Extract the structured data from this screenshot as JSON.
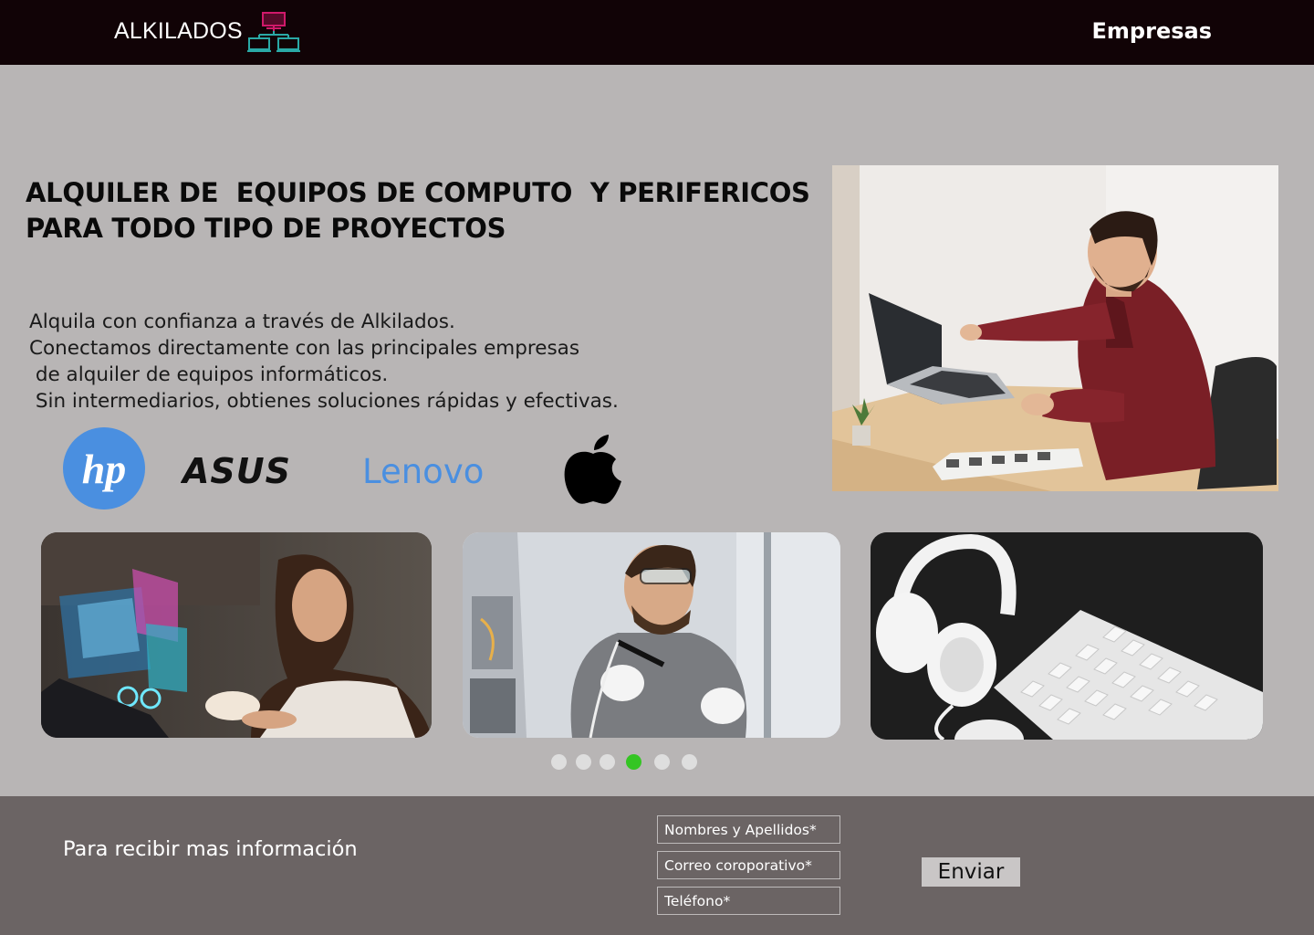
{
  "header": {
    "brand": "ALKILADOS",
    "logo_icon": "network-computers-icon",
    "nav_link": "Empresas"
  },
  "hero": {
    "headline_line1": "ALQUILER DE  EQUIPOS DE COMPUTO  Y PERIFERICOS",
    "headline_line2": "PARA TODO TIPO DE PROYECTOS",
    "intro_lines": [
      "Alquila con confianza a través de Alkilados.",
      "Conectamos directamente con las principales empresas",
      " de alquiler de equipos informáticos.",
      " Sin intermediarios, obtienes soluciones rápidas y efectivas."
    ],
    "photo": "man-working-on-laptop-photo"
  },
  "brands": {
    "hp": "hp",
    "asus": "ASUS",
    "lenovo": "Lenovo",
    "apple": "apple-logo-icon"
  },
  "gallery": {
    "images": [
      "woman-with-holographic-screens-photo",
      "technician-soldering-computer-photo",
      "headphones-and-keyboard-photo"
    ],
    "dots_total": 6,
    "active_dot": 4,
    "colors": {
      "dot": "#dedede",
      "active": "#34c523"
    }
  },
  "form": {
    "title": "Para recibir mas información",
    "name_placeholder": "Nombres y Apellidos*",
    "email_placeholder": "Correo coroporativo*",
    "phone_placeholder": "Teléfono*",
    "submit_label": "Enviar"
  },
  "colors": {
    "header_bg": "#110306",
    "page_bg": "#b8b5b5",
    "footer_bg": "#6b6464",
    "logo_magenta": "#d0196a",
    "logo_teal": "#2aa9a6"
  }
}
